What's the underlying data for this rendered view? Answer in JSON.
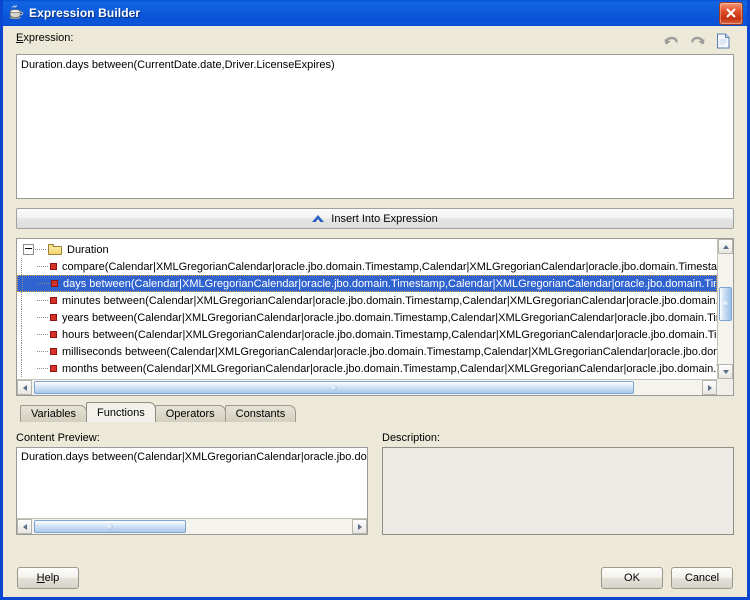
{
  "window": {
    "title": "Expression Builder",
    "icon": "java-coffee-cup-icon",
    "close_label": "×"
  },
  "toolbar": {
    "undo_icon": "undo-icon",
    "redo_icon": "redo-icon",
    "new_icon": "new-document-icon"
  },
  "expression": {
    "label": "Expression:",
    "label_mnemonic": "E",
    "label_rest": "xpression:",
    "value": "Duration.days between(CurrentDate.date,Driver.LicenseExpires)"
  },
  "insert": {
    "label": "Insert Into Expression",
    "icon": "chevron-up-icon"
  },
  "tree": {
    "root": {
      "label": "Duration",
      "icon": "folder-icon",
      "expanded": true
    },
    "items": [
      {
        "label": "compare(Calendar|XMLGregorianCalendar|oracle.jbo.domain.Timestamp,Calendar|XMLGregorianCalendar|oracle.jbo.domain.Timestamp)",
        "selected": false
      },
      {
        "label": "days between(Calendar|XMLGregorianCalendar|oracle.jbo.domain.Timestamp,Calendar|XMLGregorianCalendar|oracle.jbo.domain.Timestamp)",
        "selected": true
      },
      {
        "label": "minutes between(Calendar|XMLGregorianCalendar|oracle.jbo.domain.Timestamp,Calendar|XMLGregorianCalendar|oracle.jbo.domain.Timestamp)",
        "selected": false
      },
      {
        "label": "years between(Calendar|XMLGregorianCalendar|oracle.jbo.domain.Timestamp,Calendar|XMLGregorianCalendar|oracle.jbo.domain.Timestamp)",
        "selected": false
      },
      {
        "label": "hours between(Calendar|XMLGregorianCalendar|oracle.jbo.domain.Timestamp,Calendar|XMLGregorianCalendar|oracle.jbo.domain.Timestamp)",
        "selected": false
      },
      {
        "label": "milliseconds between(Calendar|XMLGregorianCalendar|oracle.jbo.domain.Timestamp,Calendar|XMLGregorianCalendar|oracle.jbo.domain.Timestamp)",
        "selected": false
      },
      {
        "label": "months between(Calendar|XMLGregorianCalendar|oracle.jbo.domain.Timestamp,Calendar|XMLGregorianCalendar|oracle.jbo.domain.Timestamp)",
        "selected": false
      }
    ]
  },
  "tabs": [
    {
      "label": "Variables",
      "active": false
    },
    {
      "label": "Functions",
      "active": true
    },
    {
      "label": "Operators",
      "active": false
    },
    {
      "label": "Constants",
      "active": false
    }
  ],
  "preview": {
    "label": "Content Preview:",
    "value": "Duration.days between(Calendar|XMLGregorianCalendar|oracle.jbo.dom"
  },
  "description": {
    "label": "Description:",
    "value": ""
  },
  "footer": {
    "help_label": "Help",
    "help_mnemonic": "H",
    "help_rest": "elp",
    "ok_label": "OK",
    "cancel_label": "Cancel"
  },
  "colors": {
    "titlebar": "#0d5ddd",
    "selection": "#3163ce",
    "focus_border": "#e8a33d",
    "dialog_bg": "#ece9d8",
    "accent": "#2a63c4"
  }
}
